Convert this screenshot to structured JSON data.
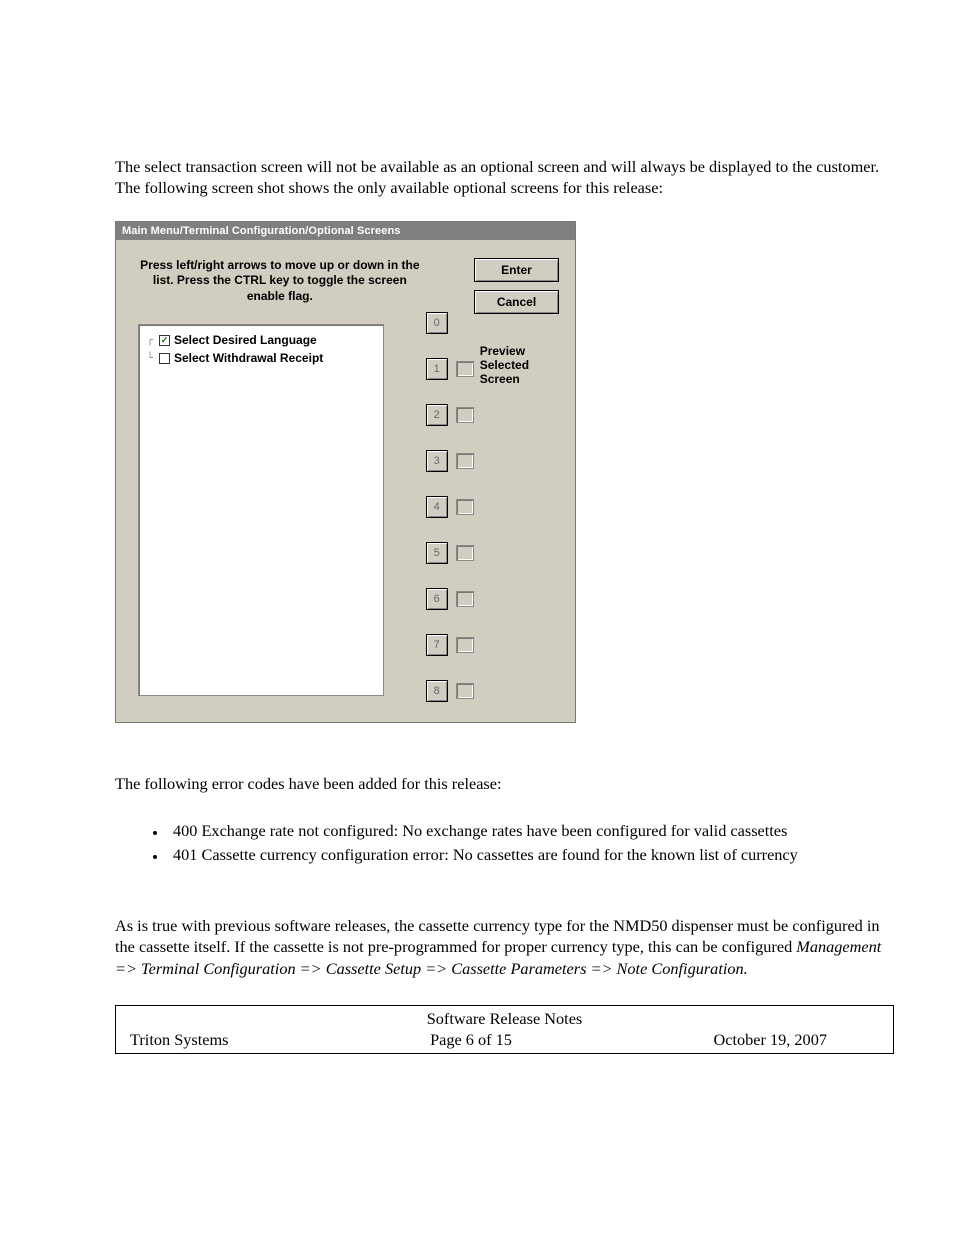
{
  "paragraphs": {
    "p1": "The select transaction screen will not be available as an optional screen and will always be displayed to the customer.  The following screen shot shows the only available optional screens for this release:",
    "p2": "The following error codes have been added for this release:",
    "p3_a": "As is true with previous software releases, the cassette currency type for the NMD50 dispenser must be configured in the cassette itself.  If the cassette is not pre-programmed for proper currency type, this can be configured ",
    "p3_b": "Management => Terminal Configuration => Cassette Setup => Cassette Parameters => Note Configuration."
  },
  "errors": [
    "400 Exchange rate not configured:  No exchange rates have been configured for valid cassettes",
    "401 Cassette currency configuration error:  No cassettes are found for the known list of currency"
  ],
  "dialog": {
    "title": "Main Menu/Terminal Configuration/Optional Screens",
    "instructions": "Press left/right arrows to move up or down in the list.  Press the CTRL key to toggle the screen enable flag.",
    "enter": "Enter",
    "cancel": "Cancel",
    "preview": "Preview Selected Screen",
    "tree": [
      {
        "label": "Select Desired Language",
        "checked": true
      },
      {
        "label": "Select Withdrawal Receipt",
        "checked": false
      }
    ],
    "nums": [
      "0",
      "1",
      "2",
      "3",
      "4",
      "5",
      "6",
      "7",
      "8"
    ]
  },
  "footer": {
    "title": "Software Release Notes",
    "left": "Triton Systems",
    "center": "Page 6 of 15",
    "right": "October 19, 2007"
  }
}
